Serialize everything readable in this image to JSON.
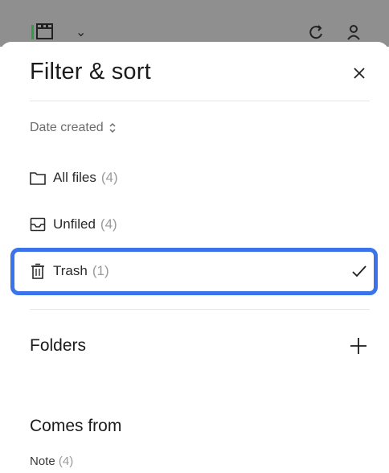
{
  "sheet": {
    "title": "Filter & sort",
    "sort_label": "Date created"
  },
  "filters": [
    {
      "label": "All files",
      "count": "(4)",
      "icon": "folder-icon"
    },
    {
      "label": "Unfiled",
      "count": "(4)",
      "icon": "inbox-icon"
    },
    {
      "label": "Trash",
      "count": "(1)",
      "icon": "trash-icon",
      "selected": true
    }
  ],
  "folders": {
    "title": "Folders"
  },
  "comes_from": {
    "title": "Comes from",
    "items": [
      {
        "label": "Note",
        "count": "(4)"
      }
    ]
  },
  "colors": {
    "highlight": "#3b73ea",
    "topbar_dim": "#8f8f8f",
    "accent_green": "#2e9e47"
  }
}
